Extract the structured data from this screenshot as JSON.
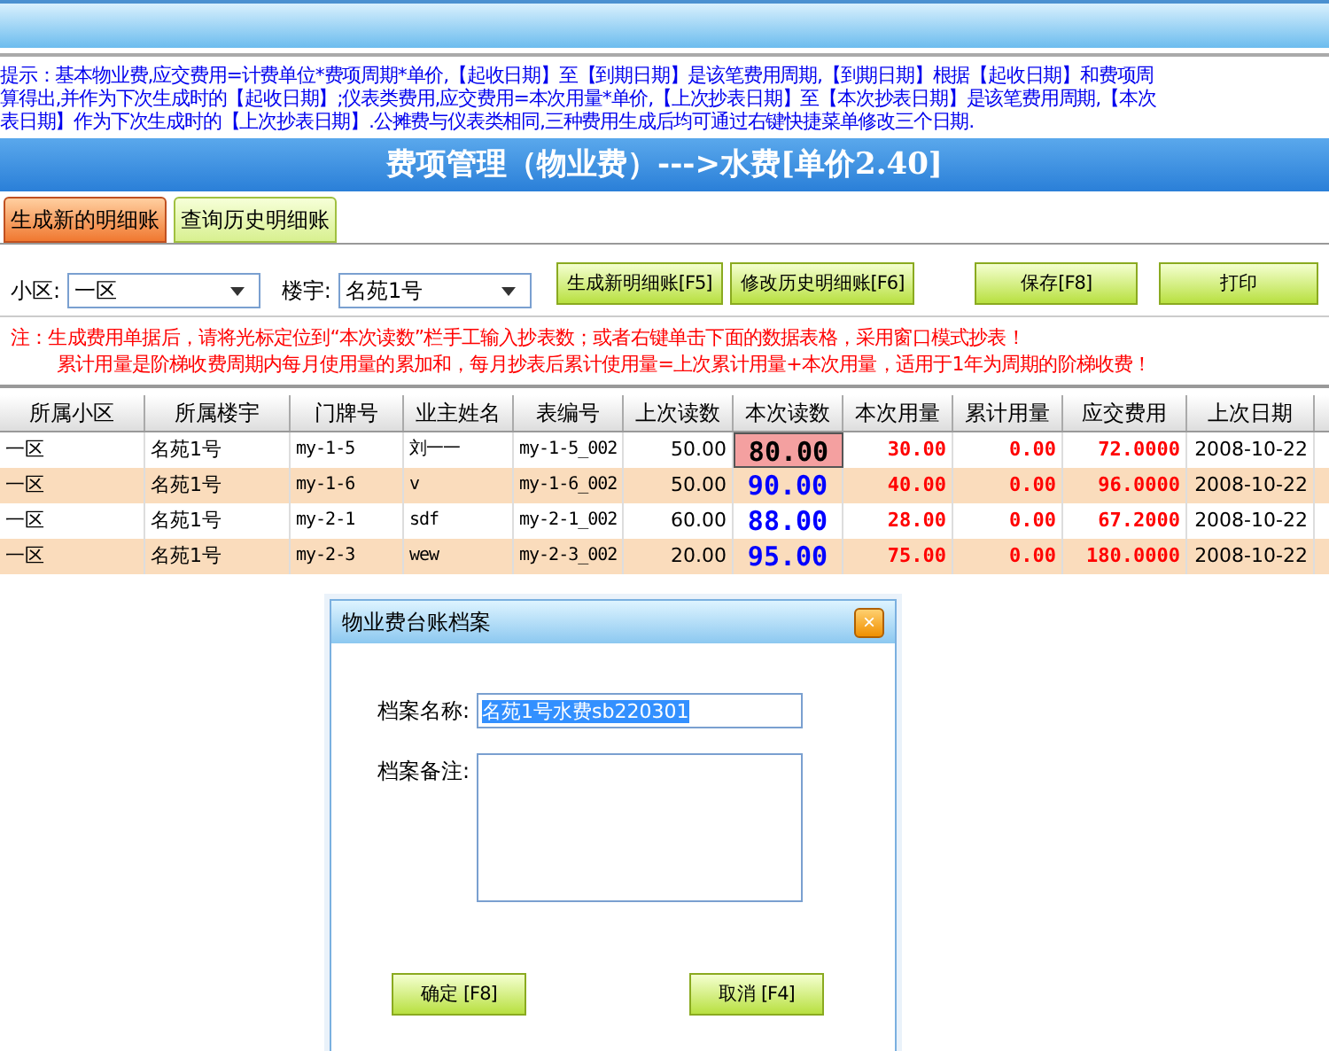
{
  "notice_lines": [
    "提示：基本物业费,应交费用=计费单位*费项周期*单价,【起收日期】至【到期日期】是该笔费用周期,【到期日期】根据【起收日期】和费项周",
    "算得出,并作为下次生成时的【起收日期】;仪表类费用,应交费用=本次用量*单价,【上次抄表日期】至【本次抄表日期】是该笔费用周期,【本次",
    "表日期】作为下次生成时的【上次抄表日期】.公摊费与仪表类相同,三种费用生成后均可通过右键快捷菜单修改三个日期."
  ],
  "title": "费项管理（物业费）--->水费[单价2.40]",
  "tabs": [
    {
      "label": "生成新的明细账",
      "selected": true
    },
    {
      "label": "查询历史明细账",
      "selected": false
    }
  ],
  "toolbar": {
    "district_label": "小区:",
    "district_value": "一区",
    "building_label": "楼宇:",
    "building_value": "名苑1号",
    "buttons": [
      "生成新明细账[F5]",
      "修改历史明细账[F6]",
      "保存[F8]",
      "打印"
    ]
  },
  "notes": [
    "注：生成费用单据后，请将光标定位到“本次读数”栏手工输入抄表数；或者右键单击下面的数据表格，采用窗口模式抄表！",
    "累计用量是阶梯收费周期内每月使用量的累加和，每月抄表后累计使用量=上次累计用量+本次用量，适用于1年为周期的阶梯收费！"
  ],
  "table": {
    "columns": [
      "所属小区",
      "所属楼宇",
      "门牌号",
      "业主姓名",
      "表编号",
      "上次读数",
      "本次读数",
      "本次用量",
      "累计用量",
      "应交费用",
      "上次日期"
    ],
    "rows": [
      {
        "cells": [
          "一区",
          "名苑1号",
          "my-1-5",
          "刘一一",
          "my-1-5_002",
          "50.00",
          "80.00",
          "30.00",
          "0.00",
          "72.0000",
          "2008-10-22"
        ],
        "focused": true
      },
      {
        "cells": [
          "一区",
          "名苑1号",
          "my-1-6",
          "v",
          "my-1-6_002",
          "50.00",
          "90.00",
          "40.00",
          "0.00",
          "96.0000",
          "2008-10-22"
        ],
        "focused": false
      },
      {
        "cells": [
          "一区",
          "名苑1号",
          "my-2-1",
          "sdf",
          "my-2-1_002",
          "60.00",
          "88.00",
          "28.00",
          "0.00",
          "67.2000",
          "2008-10-22"
        ],
        "focused": false
      },
      {
        "cells": [
          "一区",
          "名苑1号",
          "my-2-3",
          "wew",
          "my-2-3_002",
          "20.00",
          "95.00",
          "75.00",
          "0.00",
          "180.0000",
          "2008-10-22"
        ],
        "focused": false
      }
    ]
  },
  "dialog": {
    "title": "物业费台账档案",
    "close": "×",
    "name_label": "档案名称:",
    "name_value": "名苑1号水费sb220301",
    "remark_label": "档案备注:",
    "buttons": [
      "确定 [F8]",
      "取消 [F4]"
    ]
  }
}
